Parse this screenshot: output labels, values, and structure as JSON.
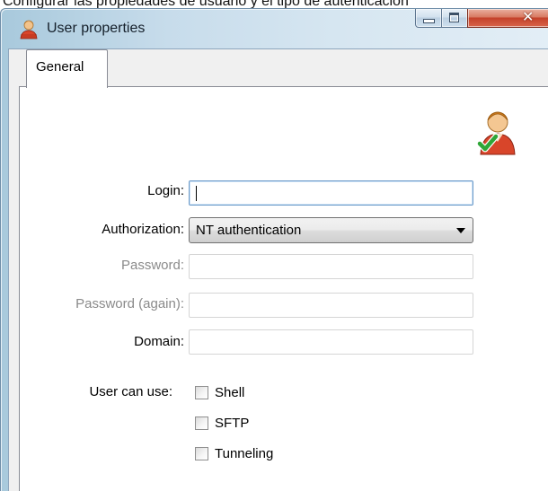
{
  "caption": "Configurar las propiedades de usuario y el tipo de autenticación",
  "window": {
    "title": "User properties"
  },
  "tabs": [
    {
      "label": "General",
      "selected": true
    }
  ],
  "form": {
    "login": {
      "label": "Login:",
      "value": ""
    },
    "authorization": {
      "label": "Authorization:",
      "selected": "NT authentication"
    },
    "password": {
      "label": "Password:",
      "value": ""
    },
    "password_again": {
      "label": "Password (again):",
      "value": ""
    },
    "domain": {
      "label": "Domain:",
      "value": ""
    },
    "user_can_use": {
      "label": "User can use:",
      "options": [
        {
          "label": "Shell",
          "checked": false
        },
        {
          "label": "SFTP",
          "checked": false
        },
        {
          "label": "Tunneling",
          "checked": false
        }
      ]
    }
  },
  "icons": {
    "app": "user-icon",
    "badge": "user-check-icon"
  },
  "colors": {
    "close_button": "#c4412a",
    "focus_border": "#6c9bc9"
  }
}
